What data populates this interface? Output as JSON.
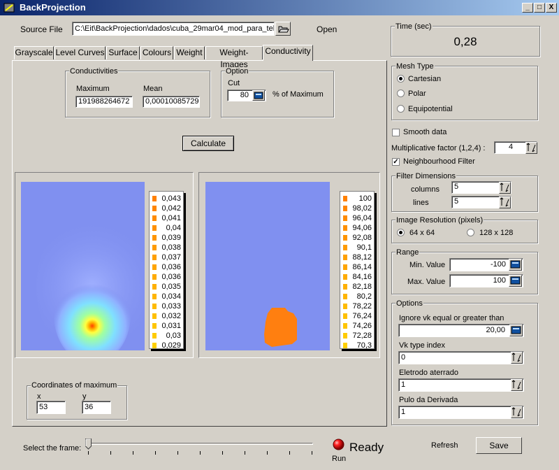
{
  "window": {
    "title": "BackProjection",
    "minimize": "_",
    "maximize": "□",
    "close": "X"
  },
  "source": {
    "label": "Source File",
    "value": "C:\\Eit\\BackProjection\\dados\\cuba_29mar04_mod_para_tel",
    "open_label": "Open"
  },
  "tabs": [
    {
      "label": "Grayscale"
    },
    {
      "label": "Level Curves"
    },
    {
      "label": "Surface"
    },
    {
      "label": "Colours"
    },
    {
      "label": "Weight"
    },
    {
      "label": "Weight-Images"
    },
    {
      "label": "Conductivity",
      "active": true
    }
  ],
  "conductivities": {
    "title": "Conductivities",
    "max_label": "Maximum",
    "max_value": "191988264672",
    "mean_label": "Mean",
    "mean_value": "0,00010085729"
  },
  "option": {
    "title": "Option",
    "cut_label": "Cut",
    "cut_value": "80",
    "percent_label": "% of Maximum"
  },
  "calculate_label": "Calculate",
  "left_scale": [
    "0,043",
    "0,042",
    "0,041",
    "0,04",
    "0,039",
    "0,038",
    "0,037",
    "0,036",
    "0,036",
    "0,035",
    "0,034",
    "0,033",
    "0,032",
    "0,031",
    "0,03",
    "0,029"
  ],
  "right_scale": [
    "100",
    "98,02",
    "96,04",
    "94,06",
    "92,08",
    "90,1",
    "88,12",
    "86,14",
    "84,16",
    "82,18",
    "80,2",
    "78,22",
    "76,24",
    "74,26",
    "72,28",
    "70,3"
  ],
  "coordinates": {
    "title": "Coordinates of maximum",
    "x_label": "x",
    "x_value": "53",
    "y_label": "y",
    "y_value": "36"
  },
  "time": {
    "title": "Time (sec)",
    "value": "0,28"
  },
  "mesh": {
    "title": "Mesh Type",
    "options": [
      {
        "label": "Cartesian",
        "selected": true
      },
      {
        "label": "Polar",
        "selected": false
      },
      {
        "label": "Equipotential",
        "selected": false
      }
    ]
  },
  "smooth": {
    "label": "Smooth data",
    "checked": false
  },
  "multiplicative": {
    "label": "Multiplicative factor (1,2,4) :",
    "value": "4"
  },
  "neighbourhood": {
    "label": "Neighbourhood Filter",
    "checked": true
  },
  "filter": {
    "title": "Filter Dimensions",
    "columns_label": "columns",
    "columns_value": "5",
    "lines_label": "lines",
    "lines_value": "5"
  },
  "resolution": {
    "title": "Image Resolution (pixels)",
    "opt1": "64 x 64",
    "opt2": "128 x 128",
    "selected": "64 x 64"
  },
  "range": {
    "title": "Range",
    "min_label": "Min. Value",
    "min_value": "-100",
    "max_label": "Max. Value",
    "max_value": "100"
  },
  "options": {
    "title": "Options",
    "ignore_label": "Ignore vk equal or greater than",
    "ignore_value": "20,00",
    "vk_label": "Vk type index",
    "vk_value": "0",
    "eletrodo_label": "Eletrodo aterrado",
    "eletrodo_value": "1",
    "pulo_label": "Pulo da Derivada",
    "pulo_value": "1"
  },
  "frame": {
    "label": "Select the frame:",
    "position": 0
  },
  "run_label": "Run",
  "status": "Ready",
  "refresh_label": "Refresh",
  "save_label": "Save",
  "colors": {
    "plot_bg": "#8090f0",
    "blob": "#ff7f10",
    "swatch_orange": "#ff8000",
    "swatch_yellow": "#ffd000"
  }
}
